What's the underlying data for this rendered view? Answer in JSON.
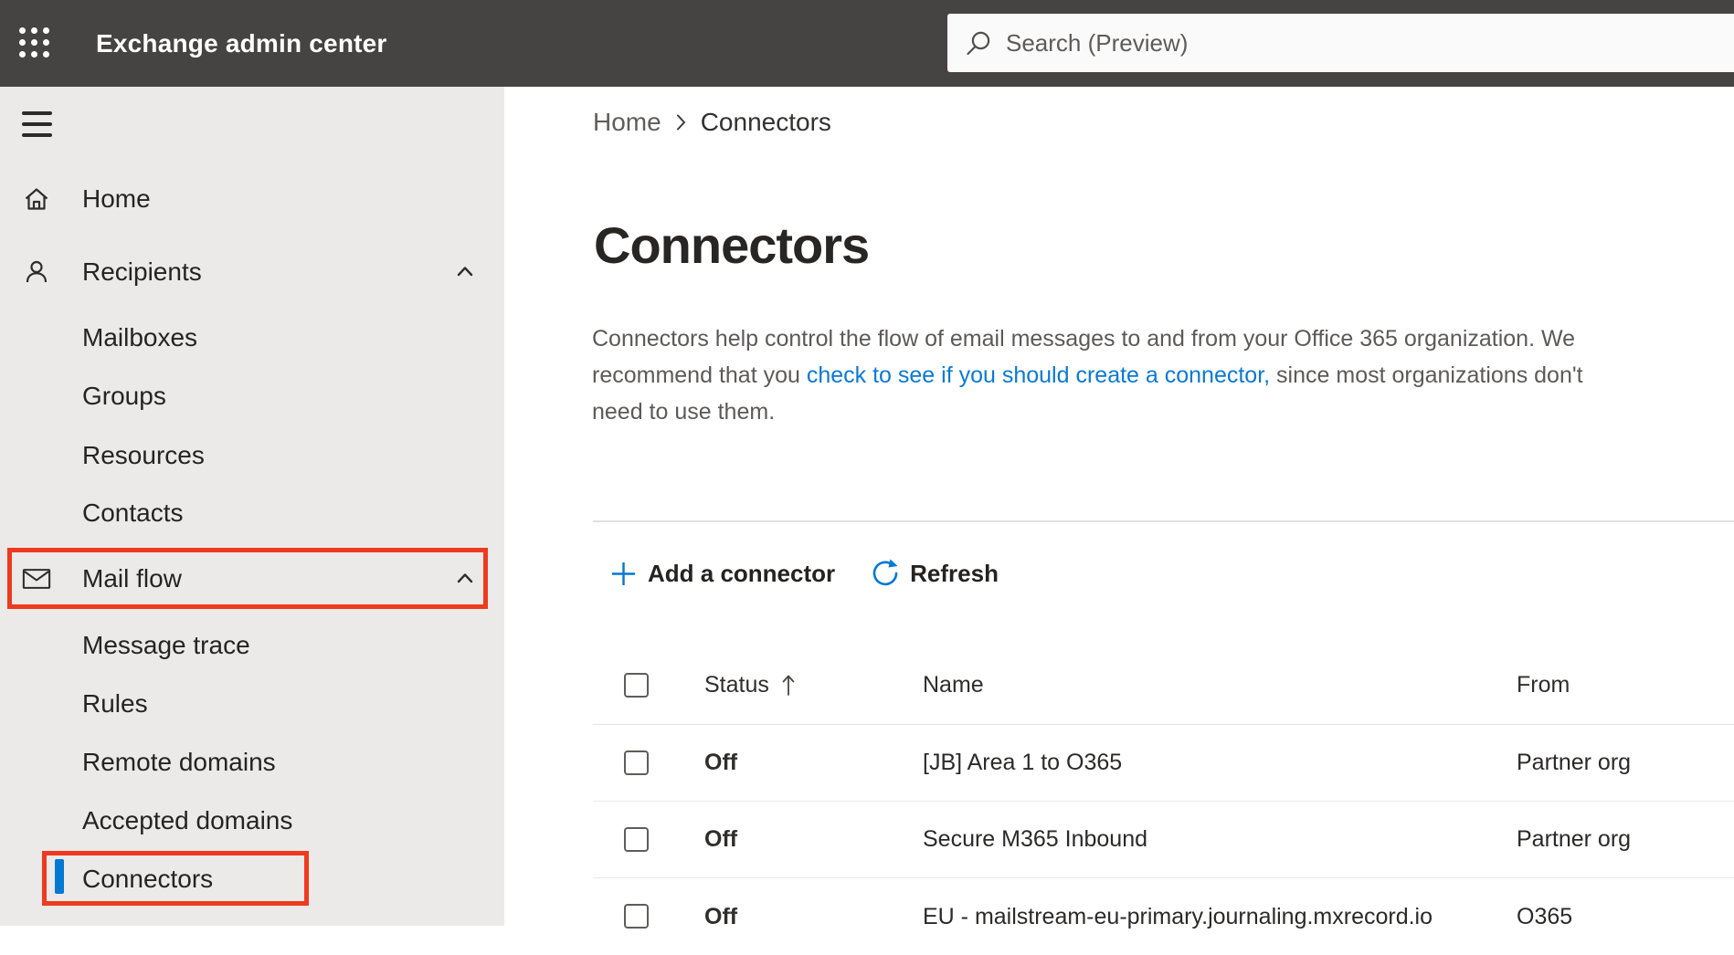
{
  "colors": {
    "topbar_bg": "#454442",
    "sidebar_bg": "#eceae9",
    "accent_blue": "#0078d4",
    "link_blue": "#0b79d4",
    "annotation_red": "#ee3a1e",
    "selection_indicator_blue": "#0078d4",
    "text_dark": "#252423",
    "text_gray": "#5c5a58"
  },
  "header": {
    "app_title": "Exchange admin center",
    "search_placeholder": "Search (Preview)"
  },
  "sidebar": {
    "items": [
      {
        "label": "Home",
        "icon": "home-icon",
        "level": "top"
      },
      {
        "label": "Recipients",
        "icon": "person-icon",
        "level": "top",
        "expanded": true
      },
      {
        "label": "Mailboxes",
        "level": "sub"
      },
      {
        "label": "Groups",
        "level": "sub"
      },
      {
        "label": "Resources",
        "level": "sub"
      },
      {
        "label": "Contacts",
        "level": "sub"
      },
      {
        "label": "Mail flow",
        "icon": "mail-icon",
        "level": "top",
        "expanded": true,
        "annotated": true
      },
      {
        "label": "Message trace",
        "level": "sub"
      },
      {
        "label": "Rules",
        "level": "sub"
      },
      {
        "label": "Remote domains",
        "level": "sub"
      },
      {
        "label": "Accepted domains",
        "level": "sub"
      },
      {
        "label": "Connectors",
        "level": "sub",
        "selected": true,
        "annotated": true
      }
    ]
  },
  "breadcrumb": {
    "home": "Home",
    "current": "Connectors"
  },
  "page": {
    "title": "Connectors",
    "desc_line1": "Connectors help control the flow of email messages to and from your Office 365 organization. We",
    "desc_line2_pre": "recommend that you ",
    "desc_link": "check to see if you should create a connector,",
    "desc_line2_post": " since most organizations don't",
    "desc_line3": "need to use them."
  },
  "toolbar": {
    "add_label": "Add a connector",
    "refresh_label": "Refresh"
  },
  "table": {
    "columns": {
      "status": "Status",
      "name": "Name",
      "from": "From"
    },
    "sort": {
      "column": "Status",
      "direction": "ascending"
    },
    "rows": [
      {
        "status": "Off",
        "name": "[JB] Area 1 to O365",
        "from": "Partner org"
      },
      {
        "status": "Off",
        "name": "Secure M365 Inbound",
        "from": "Partner org"
      },
      {
        "status": "Off",
        "name": "EU - mailstream-eu-primary.journaling.mxrecord.io",
        "from": "O365"
      }
    ]
  }
}
